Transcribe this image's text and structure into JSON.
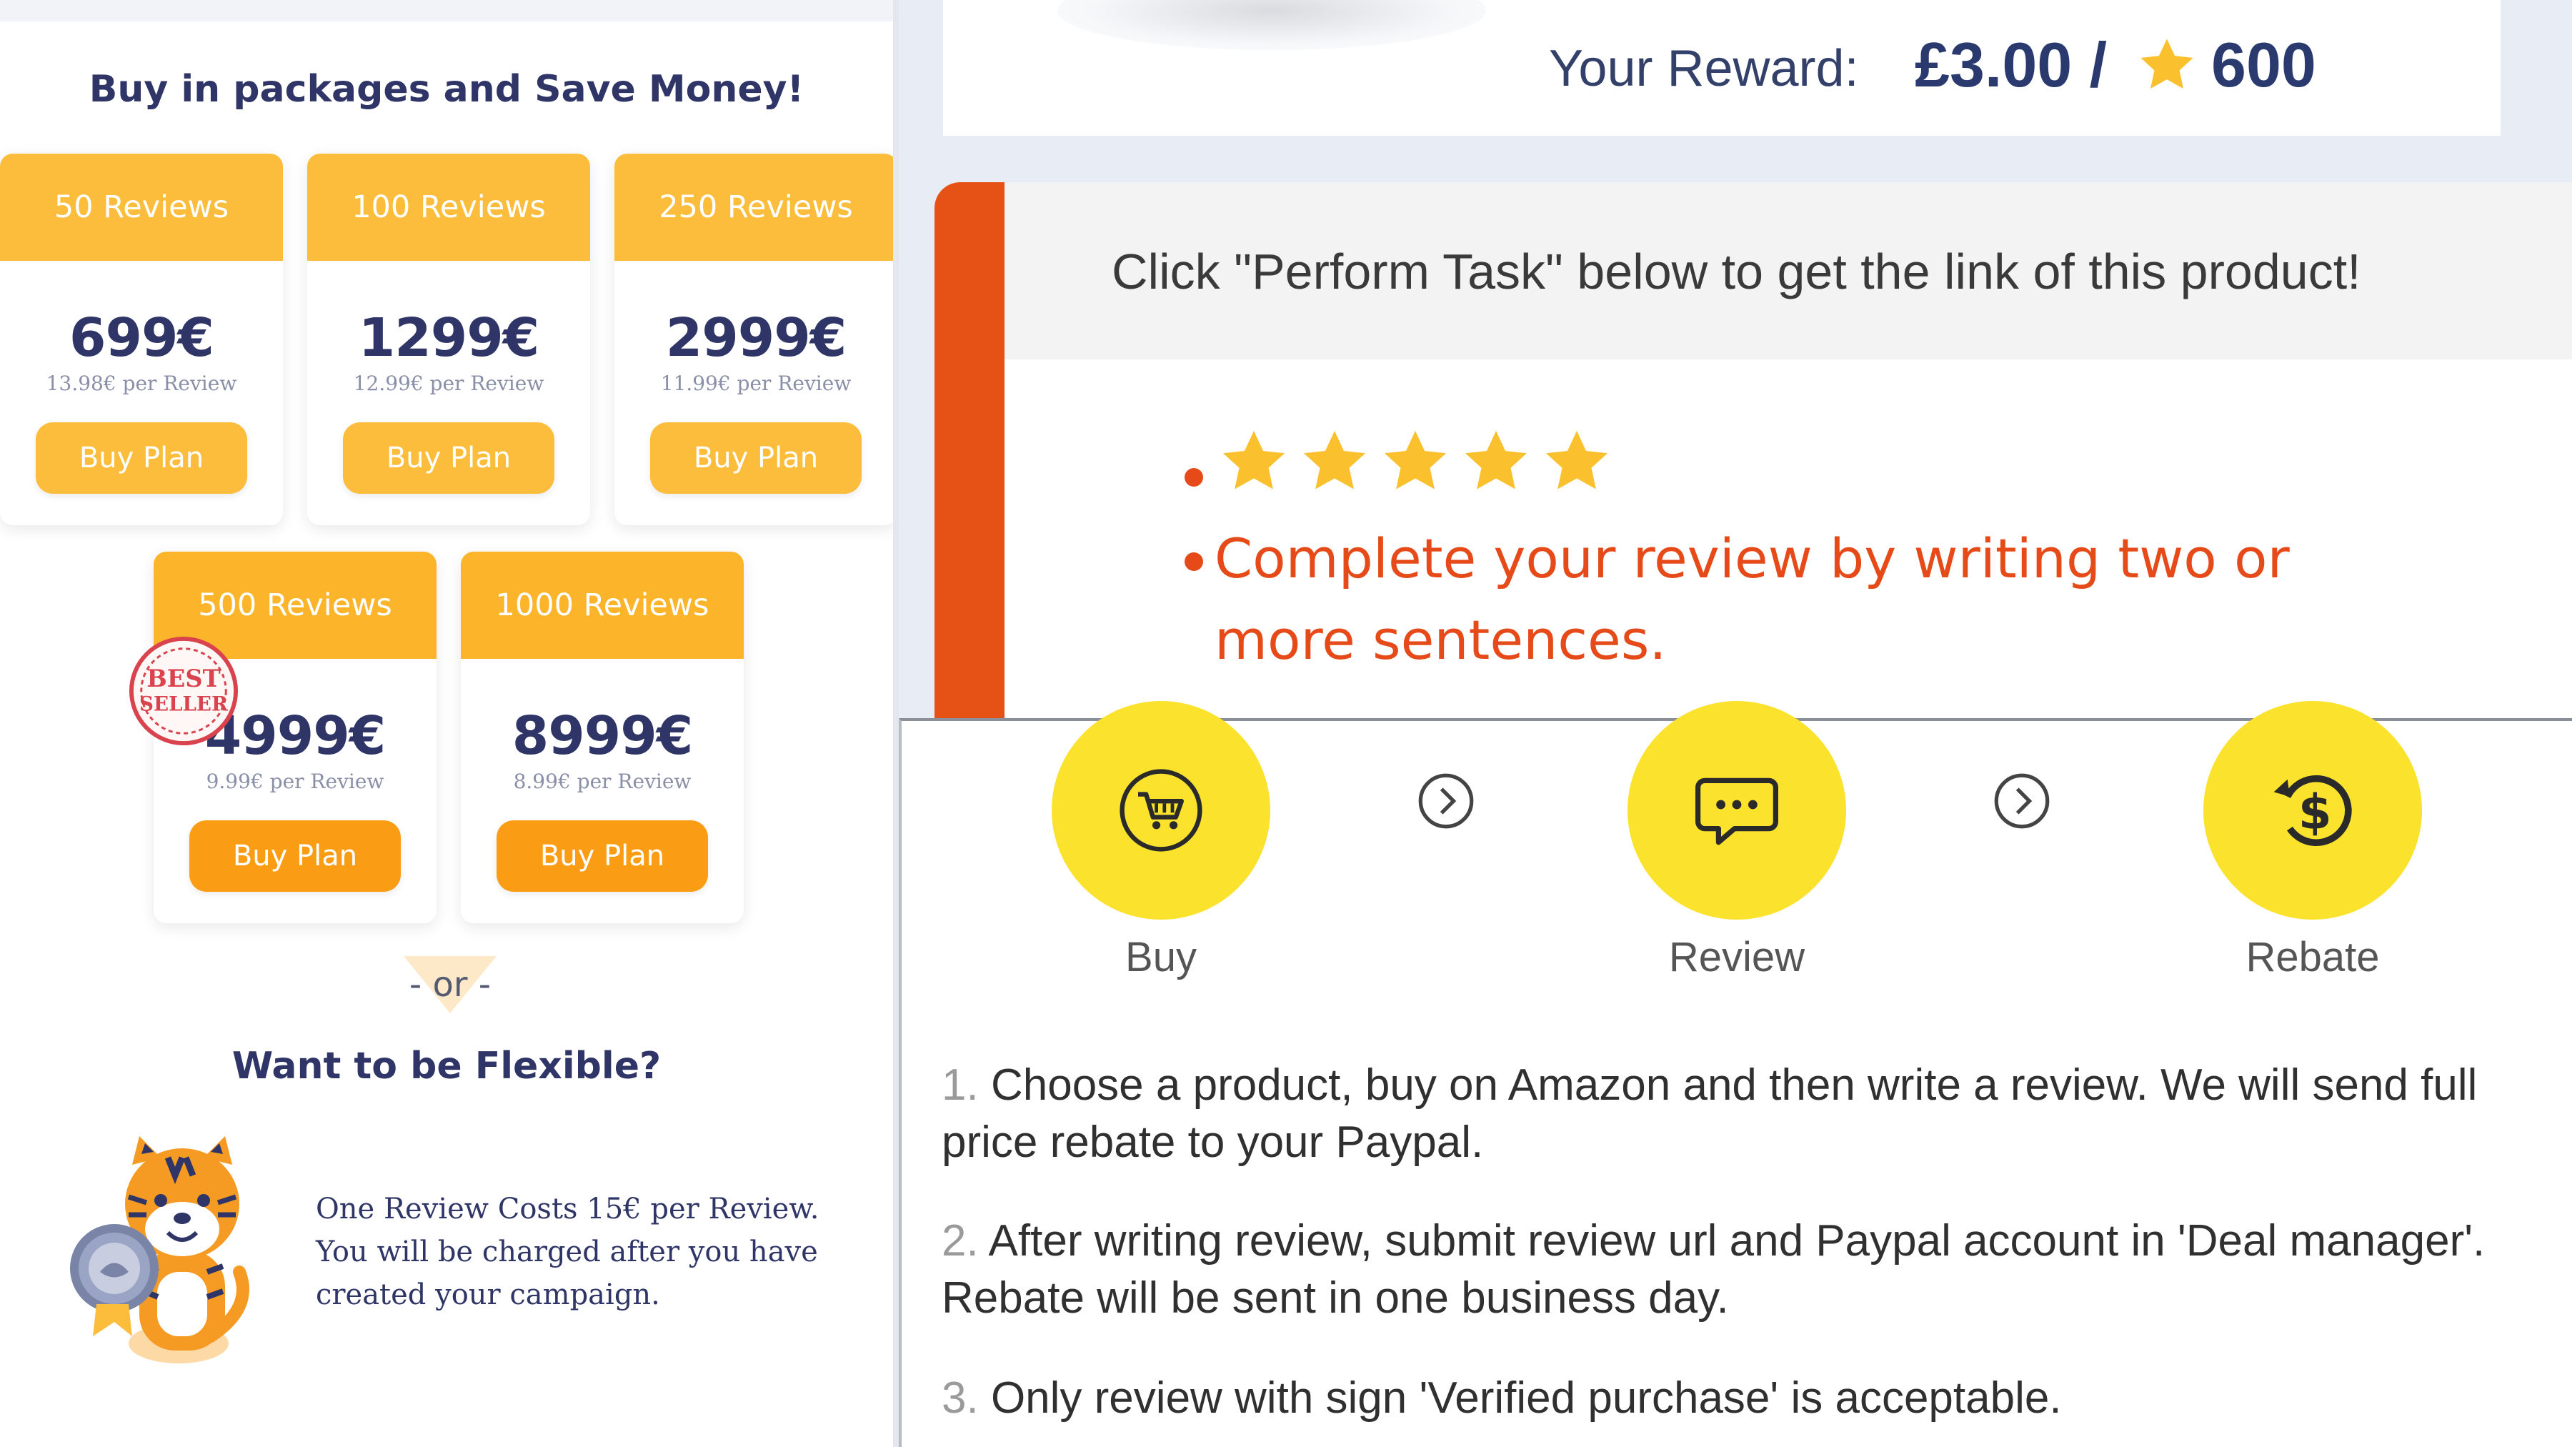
{
  "packages": {
    "heading": "Buy in packages and Save Money!",
    "plans": [
      {
        "title": "50 Reviews",
        "price": "699€",
        "per_review": "13.98€ per Review",
        "button": "Buy Plan"
      },
      {
        "title": "100 Reviews",
        "price": "1299€",
        "per_review": "12.99€ per Review",
        "button": "Buy Plan"
      },
      {
        "title": "250 Reviews",
        "price": "2999€",
        "per_review": "11.99€ per Review",
        "button": "Buy Plan"
      },
      {
        "title": "500 Reviews",
        "price": "4999€",
        "per_review": "9.99€ per Review",
        "button": "Buy Plan"
      },
      {
        "title": "1000 Reviews",
        "price": "8999€",
        "per_review": "8.99€ per Review",
        "button": "Buy Plan"
      }
    ],
    "badge": "BEST SELLER",
    "or_text": "- or -"
  },
  "flexible": {
    "heading": "Want to be Flexible?",
    "text": "One Review Costs 15€ per Review. You will be charged after you have created your campaign."
  },
  "reward": {
    "label": "Your Reward:",
    "amount": "£3.00 /",
    "points": "600"
  },
  "task": {
    "instruction": "Click \"Perform Task\" below to get the link of this product!",
    "rating_stars": 5,
    "review_instruction": "Complete your review by writing two or more sentences."
  },
  "steps": {
    "items": [
      {
        "label": "Buy",
        "icon": "shopping-cart-icon"
      },
      {
        "label": "Review",
        "icon": "chat-bubble-icon"
      },
      {
        "label": "Rebate",
        "icon": "dollar-refund-icon"
      }
    ],
    "instructions": [
      {
        "num": "1.",
        "text": "Choose a product, buy on Amazon and then write a review. We will send full price rebate to your Paypal."
      },
      {
        "num": "2.",
        "text": "After writing review, submit review url and Paypal account in 'Deal manager'. Rebate will be sent in one business day."
      },
      {
        "num": "3.",
        "text": "Only review with sign 'Verified purchase' is acceptable."
      }
    ]
  },
  "colors": {
    "plan_header": "#fbbd3b",
    "plan_button_dark": "#fb9d14",
    "heading_text": "#2f3566",
    "task_accent": "#e65116",
    "step_circle": "#fbe22c",
    "star": "#fbc02d"
  }
}
